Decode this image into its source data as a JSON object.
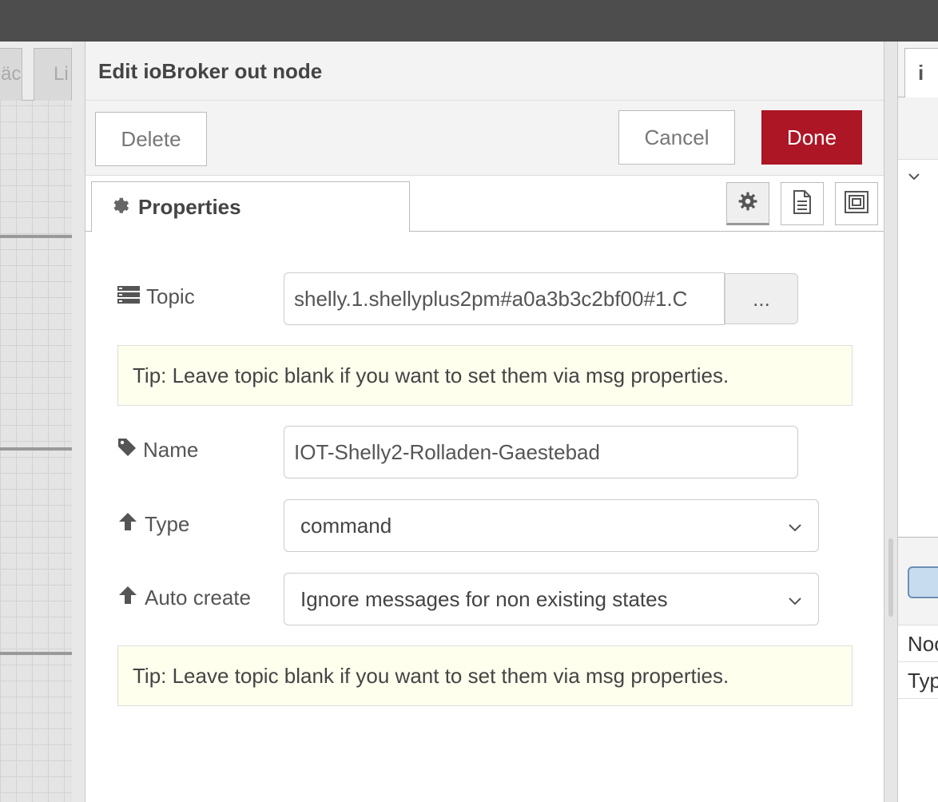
{
  "workspace": {
    "tabs": [
      "äc",
      "Li"
    ]
  },
  "dialog": {
    "title": "Edit ioBroker out node",
    "buttons": {
      "delete": "Delete",
      "cancel": "Cancel",
      "done": "Done"
    },
    "tab": {
      "label": "Properties",
      "icon": "gear-icon"
    },
    "tab_icons": [
      "gear-icon",
      "document-icon",
      "frame-icon"
    ],
    "form": {
      "topic": {
        "label": "Topic",
        "value": "shelly.1.shellyplus2pm#a0a3b3c2bf00#1.C",
        "button": "..."
      },
      "tip1": "Tip: Leave topic blank if you want to set them via msg properties.",
      "name": {
        "label": "Name",
        "value": "IOT-Shelly2-Rolladen-Gaestebad"
      },
      "type": {
        "label": "Type",
        "value": "command"
      },
      "autocreate": {
        "label": "Auto create",
        "value": "Ignore messages for non existing states"
      },
      "tip2": "Tip: Leave topic blank if you want to set them via msg properties."
    }
  },
  "sidebar": {
    "tab_label": "i",
    "rows": [
      "Noc",
      "Typ"
    ]
  },
  "colors": {
    "done_button": "#ad1625",
    "tip_background": "#ffffee",
    "topbar": "#4d4d4d"
  }
}
